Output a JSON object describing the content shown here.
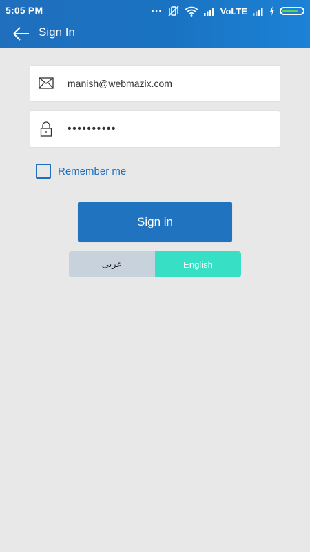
{
  "status_bar": {
    "time": "5:05 PM",
    "dots": "...",
    "network_label": "VoLTE",
    "icons": [
      "overflow-dots-icon",
      "vibrate-off-icon",
      "wifi-icon",
      "signal-icon",
      "signal-icon",
      "charging-icon",
      "battery-icon"
    ]
  },
  "app_bar": {
    "title": "Sign In",
    "back_icon": "back-arrow-icon"
  },
  "form": {
    "email": {
      "value": "manish@webmazix.com",
      "icon": "mail-icon"
    },
    "password": {
      "value": "••••••••••",
      "icon": "lock-icon"
    },
    "remember_label": "Remember me",
    "remember_checked": false,
    "signin_label": "Sign in"
  },
  "language": {
    "options": [
      {
        "label": "عربى",
        "selected": false
      },
      {
        "label": "English",
        "selected": true
      }
    ]
  },
  "colors": {
    "primary": "#1f73bf",
    "accent": "#37dfc4",
    "background": "#e8e8e8",
    "inactive_toggle": "#c7d2dc"
  }
}
